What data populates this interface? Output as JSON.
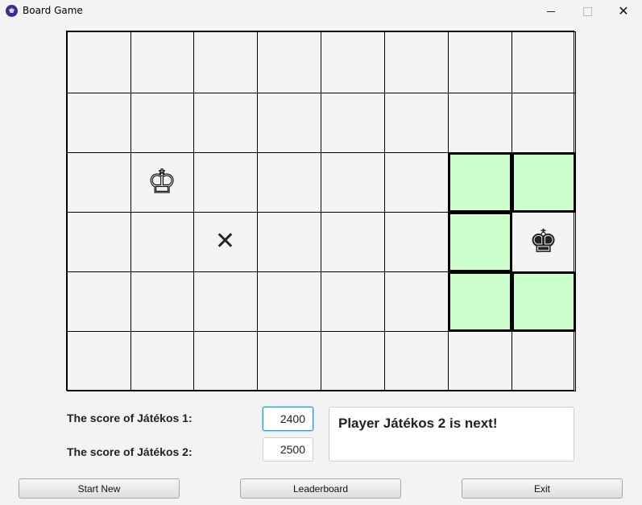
{
  "window": {
    "title": "Board Game",
    "app_icon_glyph": "♚",
    "close_glyph": "✕"
  },
  "board": {
    "rows": 6,
    "cols": 8,
    "highlight_color": "#ccffcc",
    "highlighted_cells": [
      [
        2,
        6
      ],
      [
        2,
        7
      ],
      [
        3,
        6
      ],
      [
        4,
        6
      ],
      [
        4,
        7
      ]
    ],
    "pieces": [
      {
        "row": 2,
        "col": 1,
        "type": "king",
        "color": "white",
        "glyph": "♔"
      },
      {
        "row": 3,
        "col": 7,
        "type": "king",
        "color": "black",
        "glyph": "♚"
      }
    ],
    "blocked": [
      {
        "row": 3,
        "col": 2,
        "glyph": "✕"
      }
    ]
  },
  "scores": {
    "p1_label": "The score of Játékos 1:",
    "p1_value": "2400",
    "p2_label": "The score of Játékos 2:",
    "p2_value": "2500"
  },
  "status": {
    "message": "Player Játékos 2 is next!"
  },
  "buttons": {
    "start_new": "Start New",
    "leaderboard": "Leaderboard",
    "exit": "Exit"
  }
}
